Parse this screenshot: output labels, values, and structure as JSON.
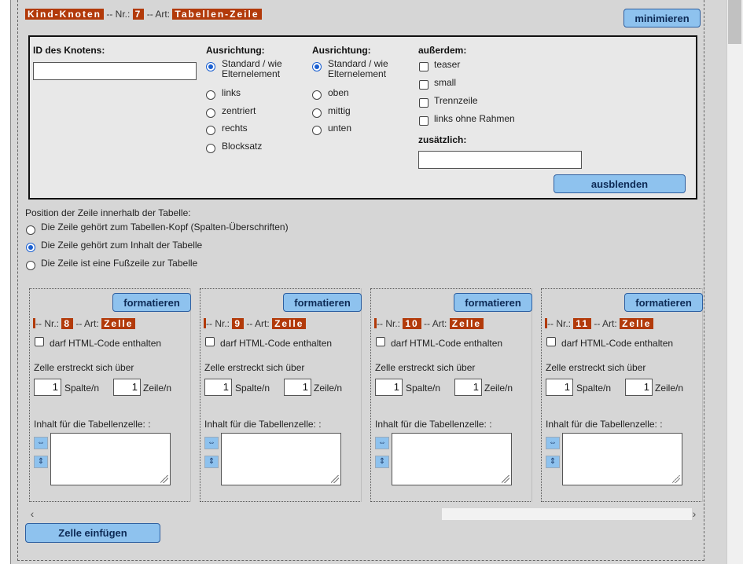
{
  "header": {
    "node_tag": "Kind-Knoten",
    "nr_prefix": "-- Nr.:",
    "nr": "7",
    "art_prefix": "-- Art:",
    "art": "Tabellen-Zeile",
    "minimize_label": "minimieren"
  },
  "panel": {
    "id_label": "ID des Knotens:",
    "id_value": "",
    "align_h": {
      "title": "Ausrichtung:",
      "options": [
        "Standard / wie Elternelement",
        "links",
        "zentriert",
        "rechts",
        "Blocksatz"
      ],
      "selected": 0
    },
    "align_v": {
      "title": "Ausrichtung:",
      "options": [
        "Standard / wie Elternelement",
        "oben",
        "mittig",
        "unten"
      ],
      "selected": 0
    },
    "extra": {
      "title": "außerdem:",
      "options": [
        "teaser",
        "small",
        "Trennzeile",
        "links ohne Rahmen"
      ],
      "additional_label": "zusätzlich:",
      "additional_value": ""
    },
    "hide_label": "ausblenden"
  },
  "position": {
    "title": "Position der Zeile innerhalb der Tabelle:",
    "options": [
      "Die Zeile gehört zum Tabellen-Kopf (Spalten-Überschriften)",
      "Die Zeile gehört zum Inhalt der Tabelle",
      "Die Zeile ist eine Fußzeile zur Tabelle"
    ],
    "selected": 1
  },
  "cells": [
    {
      "format_label": "formatieren",
      "nr_prefix": "-- Nr.:",
      "nr": "8",
      "art_prefix": "-- Art:",
      "art": "Zelle",
      "html_label": "darf HTML-Code enthalten",
      "span_label": "Zelle erstreckt sich über",
      "cols": "1",
      "cols_label": "Spalte/n",
      "rows": "1",
      "rows_label": "Zeile/n",
      "content_label": "Inhalt für die Tabellenzelle: :"
    },
    {
      "format_label": "formatieren",
      "nr_prefix": "-- Nr.:",
      "nr": "9",
      "art_prefix": "-- Art:",
      "art": "Zelle",
      "html_label": "darf HTML-Code enthalten",
      "span_label": "Zelle erstreckt sich über",
      "cols": "1",
      "cols_label": "Spalte/n",
      "rows": "1",
      "rows_label": "Zeile/n",
      "content_label": "Inhalt für die Tabellenzelle: :"
    },
    {
      "format_label": "formatieren",
      "nr_prefix": "-- Nr.:",
      "nr": "10",
      "art_prefix": "-- Art:",
      "art": "Zelle",
      "html_label": "darf HTML-Code enthalten",
      "span_label": "Zelle erstreckt sich über",
      "cols": "1",
      "cols_label": "Spalte/n",
      "rows": "1",
      "rows_label": "Zeile/n",
      "content_label": "Inhalt für die Tabellenzelle: :"
    },
    {
      "format_label": "formatieren",
      "nr_prefix": "-- Nr.:",
      "nr": "11",
      "art_prefix": "-- Art:",
      "art": "Zelle",
      "html_label": "darf HTML-Code enthalten",
      "span_label": "Zelle erstreckt sich über",
      "cols": "1",
      "cols_label": "Spalte/n",
      "rows": "1",
      "rows_label": "Zeile/n",
      "content_label": "Inhalt für die Tabellenzelle: :"
    }
  ],
  "icons": {
    "expand_h": "⇔",
    "expand_v": "⇕",
    "scroll_left": "‹",
    "scroll_right": "›"
  },
  "footer": {
    "insert_cell_label": "Zelle einfügen"
  },
  "colors": {
    "tag_bg": "#b23a0a",
    "button_bg": "#8ec2ee",
    "radio_on": "#1a5fd0"
  }
}
